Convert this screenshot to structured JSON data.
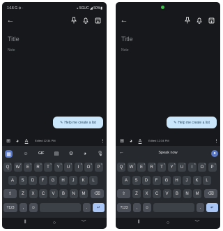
{
  "left": {
    "status": {
      "time": "1:16",
      "left_icons": "G ⊙ ·",
      "right": "⁎ 5GUC ◢ 50%▮"
    },
    "header": {
      "back_icon": "arrow-left-icon",
      "pin_icon": "pin-icon",
      "bell_icon": "bell-icon",
      "archive_icon": "archive-icon"
    },
    "editor": {
      "title_placeholder": "Title",
      "note_placeholder": "Note"
    },
    "suggestion_chip": {
      "label": "Help me create a list"
    },
    "edit_toolbar": {
      "edited": "Edited 12:34 PM"
    },
    "keyboard_toolbar": {
      "gif": "GIF"
    },
    "keys": {
      "row1": [
        "Q",
        "W",
        "E",
        "R",
        "T",
        "Y",
        "U",
        "I",
        "O",
        "P"
      ],
      "row1_sup": [
        "1",
        "2",
        "3",
        "4",
        "5",
        "6",
        "7",
        "8",
        "9",
        "0"
      ],
      "row2": [
        "A",
        "S",
        "D",
        "F",
        "G",
        "H",
        "J",
        "K",
        "L"
      ],
      "row3": [
        "Z",
        "X",
        "C",
        "V",
        "B",
        "N",
        "M"
      ],
      "sym": "?123",
      "comma": ",",
      "period": "."
    }
  },
  "right": {
    "header": {
      "back_icon": "arrow-left-icon",
      "pin_icon": "pin-icon",
      "bell_icon": "bell-icon",
      "archive_icon": "archive-icon"
    },
    "editor": {
      "title_placeholder": "Title",
      "note_placeholder": "Note"
    },
    "suggestion_chip": {
      "label": "Help me create a list"
    },
    "edit_toolbar": {
      "edited": "Edited 12:34 PM"
    },
    "voice": {
      "speak_now": "Speak now"
    },
    "keys": {
      "row1": [
        "Q",
        "W",
        "E",
        "R",
        "T",
        "Y",
        "U",
        "I",
        "O",
        "P"
      ],
      "row1_sup": [
        "1",
        "2",
        "3",
        "4",
        "5",
        "6",
        "7",
        "8",
        "9",
        "0"
      ],
      "row2": [
        "A",
        "S",
        "D",
        "F",
        "G",
        "H",
        "J",
        "K",
        "L"
      ],
      "row3": [
        "Z",
        "X",
        "C",
        "V",
        "B",
        "N",
        "M"
      ],
      "sym": "?123",
      "comma": ",",
      "period": "."
    }
  },
  "colors": {
    "background": "#16181c",
    "keyboard": "#26292e",
    "key": "#3c4047",
    "accent": "#5a79c8",
    "chip": "#c9e6fb"
  }
}
